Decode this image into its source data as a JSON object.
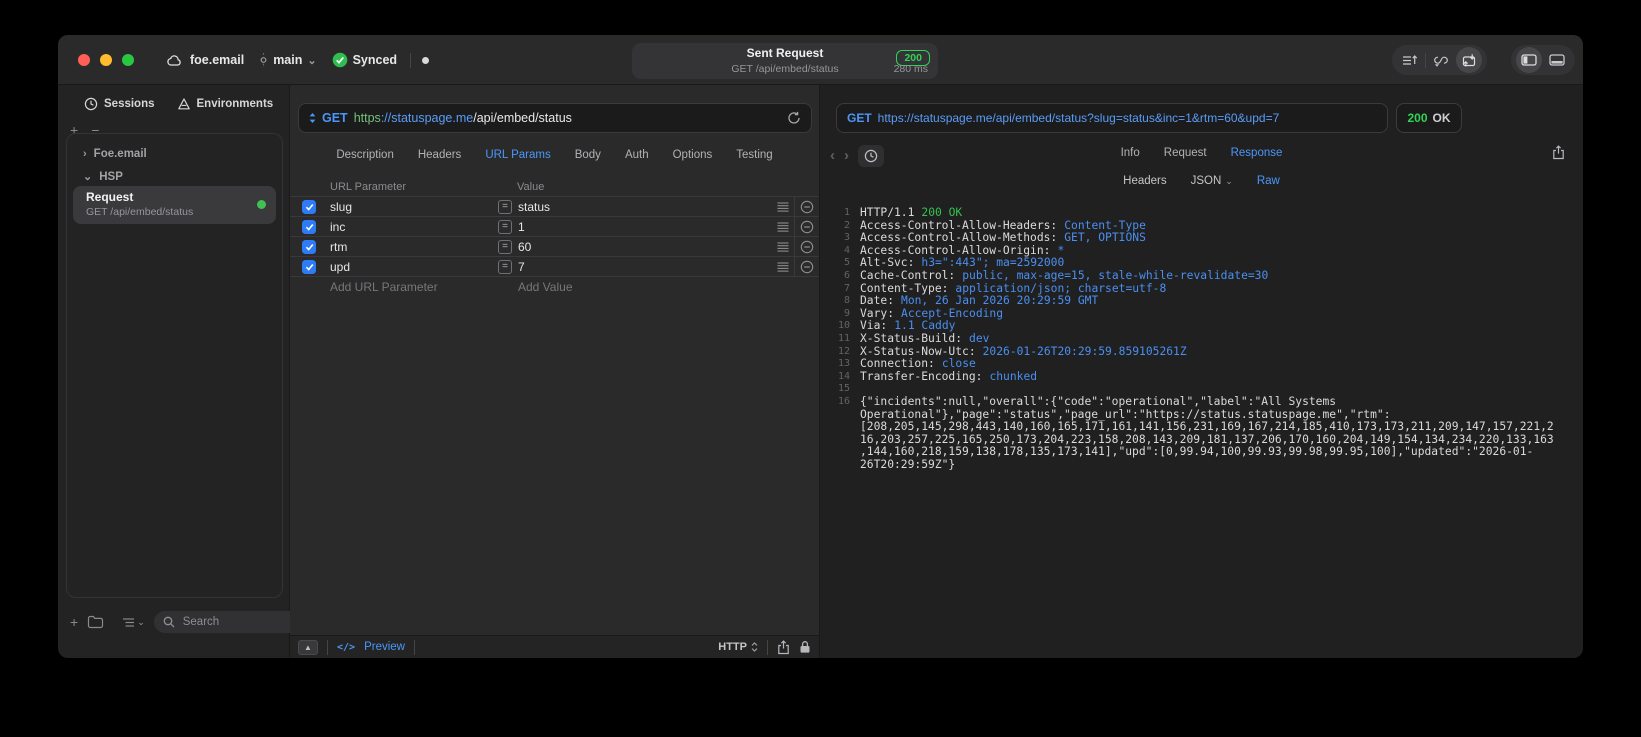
{
  "titlebar": {
    "project": "foe.email",
    "branch": "main",
    "sync_label": "Synced",
    "center": {
      "title": "Sent Request",
      "status_code": "200",
      "request_line": "GET /api/embed/status",
      "duration": "280 ms"
    }
  },
  "sidebar": {
    "tabs": [
      {
        "label": "Sessions"
      },
      {
        "label": "Environments"
      }
    ],
    "tree": {
      "item1": "Foe.email",
      "item2": "HSP"
    },
    "request_item": {
      "title": "Request",
      "subtitle": "GET /api/embed/status"
    },
    "search_placeholder": "Search"
  },
  "request": {
    "method": "GET",
    "url": {
      "scheme": "https",
      "host": "://statuspage.me",
      "path": "/api/embed/status"
    },
    "tabs": [
      {
        "label": "Description"
      },
      {
        "label": "Headers"
      },
      {
        "label": "URL Params",
        "active": true
      },
      {
        "label": "Body"
      },
      {
        "label": "Auth"
      },
      {
        "label": "Options"
      },
      {
        "label": "Testing"
      }
    ],
    "params": {
      "col_name": "URL Parameter",
      "col_value": "Value",
      "rows": [
        {
          "name": "slug",
          "value": "status",
          "enabled": true
        },
        {
          "name": "inc",
          "value": "1",
          "enabled": true
        },
        {
          "name": "rtm",
          "value": "60",
          "enabled": true
        },
        {
          "name": "upd",
          "value": "7",
          "enabled": true
        }
      ],
      "add_name": "Add URL Parameter",
      "add_value": "Add Value"
    },
    "footer": {
      "code_glyph": "</>",
      "preview": "Preview",
      "protocol": "HTTP"
    }
  },
  "response": {
    "method": "GET",
    "url": "https://statuspage.me/api/embed/status?slug=status&inc=1&rtm=60&upd=7",
    "status_code": "200",
    "status_text": "OK",
    "tabs": {
      "info": "Info",
      "request": "Request",
      "response": "Response"
    },
    "subtabs": {
      "headers": "Headers",
      "json": "JSON",
      "raw": "Raw"
    },
    "status_line": {
      "num": "1",
      "protocol": "HTTP/1.1",
      "status": "200 OK"
    },
    "headers": [
      {
        "num": "2",
        "name": "Access-Control-Allow-Headers:",
        "value": "Content-Type"
      },
      {
        "num": "3",
        "name": "Access-Control-Allow-Methods:",
        "value": "GET, OPTIONS"
      },
      {
        "num": "4",
        "name": "Access-Control-Allow-Origin:",
        "value": "*"
      },
      {
        "num": "5",
        "name": "Alt-Svc:",
        "value": "h3=\":443\"; ma=2592000"
      },
      {
        "num": "6",
        "name": "Cache-Control:",
        "value": "public, max-age=15, stale-while-revalidate=30"
      },
      {
        "num": "7",
        "name": "Content-Type:",
        "value": "application/json; charset=utf-8"
      },
      {
        "num": "8",
        "name": "Date:",
        "value": "Mon, 26 Jan 2026 20:29:59 GMT"
      },
      {
        "num": "9",
        "name": "Vary:",
        "value": "Accept-Encoding"
      },
      {
        "num": "10",
        "name": "Via:",
        "value": "1.1 Caddy"
      },
      {
        "num": "11",
        "name": "X-Status-Build:",
        "value": "dev"
      },
      {
        "num": "12",
        "name": "X-Status-Now-Utc:",
        "value": "2026-01-26T20:29:59.859105261Z"
      },
      {
        "num": "13",
        "name": "Connection:",
        "value": "close"
      },
      {
        "num": "14",
        "name": "Transfer-Encoding:",
        "value": "chunked"
      }
    ],
    "blank_line": {
      "num": "15"
    },
    "body_line": {
      "num": "16",
      "text": "{\"incidents\":null,\"overall\":{\"code\":\"operational\",\"label\":\"All Systems Operational\"},\"page\":\"status\",\"page_url\":\"https://status.statuspage.me\",\"rtm\":[208,205,145,298,443,140,160,165,171,161,141,156,231,169,167,214,185,410,173,173,211,209,147,157,221,216,203,257,225,165,250,173,204,223,158,208,143,209,181,137,206,170,160,204,149,154,134,234,220,133,163,144,160,218,159,138,178,135,173,141],\"upd\":[0,99.94,100,99.93,99.98,99.95,100],\"updated\":\"2026-01-26T20:29:59Z\"}"
    }
  },
  "icons": {
    "chevron_right": "›",
    "chevron_down": "⌄",
    "equals": "=",
    "nav_back": "‹",
    "nav_forward": "›",
    "up_triangle": "▲",
    "plus": "+",
    "minus": "−"
  },
  "colors": {
    "accent_blue": "#4b97f8",
    "success_green": "#32d158",
    "traffic_red": "#ff5f57",
    "traffic_yellow": "#febc2e",
    "traffic_green": "#28c840"
  }
}
